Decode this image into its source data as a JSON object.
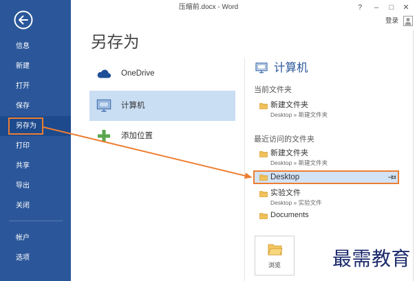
{
  "colors": {
    "sidebar": "#2B579A",
    "sidebar_selected": "#1D4A8C",
    "accent": "#2B579A",
    "selected_location": "#C9DDF3",
    "selected_folder": "#D3E3F6",
    "annotation": "#ED7D31",
    "watermark": "#1B2A6B"
  },
  "titlebar": {
    "title": "压缩前.docx - Word",
    "help": "?",
    "minimize": "–",
    "maximize": "□",
    "close": "✕",
    "signin": "登录",
    "avatar_icon": "user-avatar-icon"
  },
  "sidebar": {
    "back_icon": "back-arrow-icon",
    "items": [
      {
        "label": "信息"
      },
      {
        "label": "新建"
      },
      {
        "label": "打开"
      },
      {
        "label": "保存"
      },
      {
        "label": "另存为",
        "selected": true
      },
      {
        "label": "打印"
      },
      {
        "label": "共享"
      },
      {
        "label": "导出"
      },
      {
        "label": "关闭"
      }
    ],
    "footer_items": [
      {
        "label": "帐户"
      },
      {
        "label": "选项"
      }
    ]
  },
  "main": {
    "heading": "另存为",
    "locations": [
      {
        "label": "OneDrive",
        "icon": "onedrive-cloud-icon"
      },
      {
        "label": "计算机",
        "icon": "computer-icon",
        "selected": true
      },
      {
        "label": "添加位置",
        "icon": "add-location-plus-icon"
      }
    ]
  },
  "computer_panel": {
    "title": "计算机",
    "icon": "computer-icon",
    "current_label": "当前文件夹",
    "current_folders": [
      {
        "name": "新建文件夹",
        "path": "Desktop » 新建文件夹",
        "icon": "folder-icon"
      }
    ],
    "recent_label": "最近访问的文件夹",
    "recent_folders": [
      {
        "name": "新建文件夹",
        "path": "Desktop » 新建文件夹",
        "icon": "folder-icon"
      },
      {
        "name": "Desktop",
        "icon": "folder-icon",
        "selected": true,
        "action_icon": "pin-icon"
      },
      {
        "name": "实验文件",
        "path": "Desktop » 实验文件",
        "icon": "folder-icon"
      },
      {
        "name": "Documents",
        "icon": "folder-icon"
      }
    ],
    "browse": {
      "label": "浏览",
      "icon": "browse-folder-icon"
    }
  },
  "watermark": "最需教育"
}
